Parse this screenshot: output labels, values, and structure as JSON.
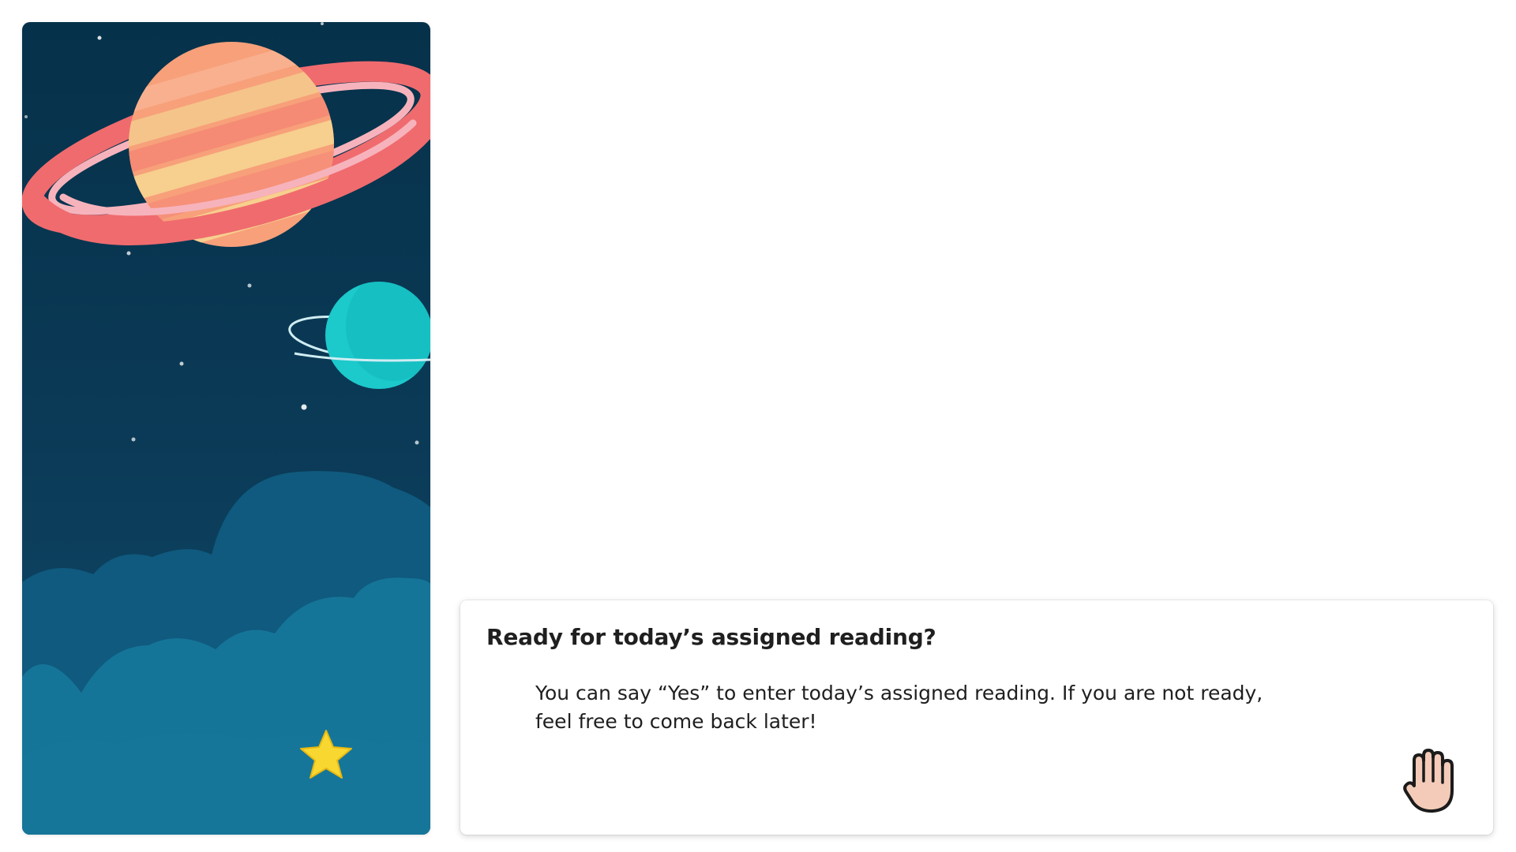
{
  "dialog": {
    "title": "Ready for today’s assigned reading?",
    "body": "You can say “Yes” to enter today’s assigned reading. If you are not ready, feel free to come back later!"
  },
  "icons": {
    "illustration": "space-scene-illustration",
    "hand": "raise-hand-icon"
  },
  "colors": {
    "sky": "#0b3550",
    "cloud_back": "#0f5a7e",
    "cloud_front": "#157599",
    "planet_main": "#f7a07a",
    "ring": "#f06b6e",
    "small_planet": "#1cc9cb",
    "star": "#f8d830",
    "hand_fill": "#f3cbb8"
  }
}
